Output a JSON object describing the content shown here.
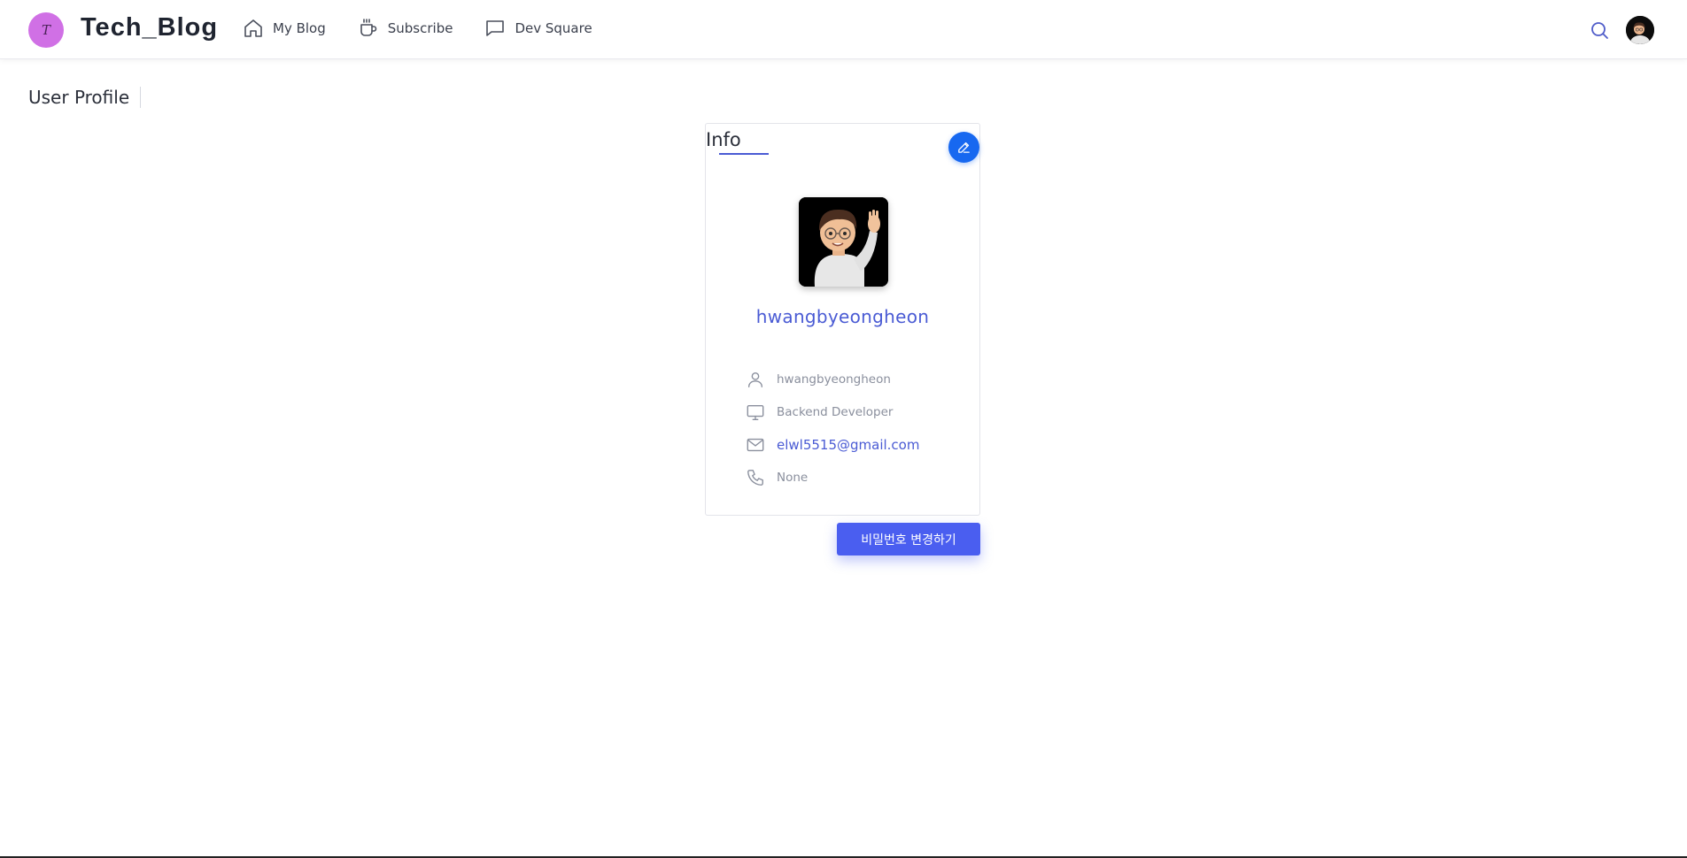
{
  "brand": {
    "logo_letter": "T",
    "name": "Tech_Blog",
    "badge_color": "#d070e5"
  },
  "nav": {
    "items": [
      {
        "label": "My Blog",
        "icon": "home-icon"
      },
      {
        "label": "Subscribe",
        "icon": "coffee-cup-icon"
      },
      {
        "label": "Dev Square",
        "icon": "message-square-icon"
      }
    ]
  },
  "header_actions": {
    "search_icon": "search-icon",
    "avatar_icon": "user-avatar"
  },
  "page": {
    "title": "User Profile"
  },
  "card": {
    "title": "Info",
    "edit_icon": "pencil-icon",
    "display_name": "hwangbyeongheon",
    "fields": {
      "username": "hwangbyeongheon",
      "job": "Backend Developer",
      "email": "elwl5515@gmail.com",
      "phone": "None"
    }
  },
  "actions": {
    "change_password_label": "비밀번호 변경하기"
  },
  "colors": {
    "accent": "#4a5bd4",
    "button": "#4a5ef0",
    "edit_button": "#1768f0"
  }
}
